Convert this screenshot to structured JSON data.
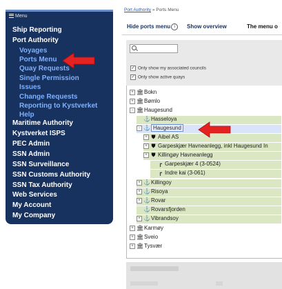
{
  "sidebar": {
    "menu_title": "Menu",
    "items": [
      {
        "label": "Ship Reporting",
        "level": 0
      },
      {
        "label": "Port Authority",
        "level": 0
      },
      {
        "label": "Voyages",
        "level": 1
      },
      {
        "label": "Ports Menu",
        "level": 1
      },
      {
        "label": "Quay Requests",
        "level": 1
      },
      {
        "label": "Single Permission",
        "level": 1
      },
      {
        "label": "Issues",
        "level": 1
      },
      {
        "label": "Change Requests",
        "level": 1
      },
      {
        "label": "Reporting to Kystverket",
        "level": 1
      },
      {
        "label": "Help",
        "level": 1
      },
      {
        "label": "Maritime Authority",
        "level": 0
      },
      {
        "label": "Kystverket ISPS",
        "level": 0
      },
      {
        "label": "PEC Admin",
        "level": 0
      },
      {
        "label": "SSN Admin",
        "level": 0
      },
      {
        "label": "SSN Surveillance",
        "level": 0
      },
      {
        "label": "SSN Customs Authority",
        "level": 0
      },
      {
        "label": "SSN Tax Authority",
        "level": 0
      },
      {
        "label": "Web Services",
        "level": 0
      },
      {
        "label": "My Account",
        "level": 0
      },
      {
        "label": "My Company",
        "level": 0
      }
    ]
  },
  "breadcrumb": {
    "link": "Port Authority",
    "separator": " » ",
    "current": "Ports Menu"
  },
  "toolbar": {
    "hide_label": "Hide ports menu",
    "info_glyph": "i",
    "overview_label": "Show overview",
    "menu_text": "The menu o"
  },
  "filters": {
    "search_value": "",
    "associated_councils_label": "Only show my associated councils",
    "active_quays_label": "Only show active quays",
    "associated_councils_checked": true,
    "active_quays_checked": true
  },
  "tree": [
    {
      "label": "Bokn",
      "icon": "building-icon",
      "expander": "+",
      "green": false,
      "selected": false
    },
    {
      "label": "Bømlo",
      "icon": "building-icon",
      "expander": "+",
      "green": false,
      "selected": false
    },
    {
      "label": "Haugesund",
      "icon": "building-icon",
      "expander": "−",
      "green": false,
      "selected": false
    },
    {
      "label": "Hasseloya",
      "icon": "anchor-icon",
      "expander": "",
      "green": true,
      "selected": false
    },
    {
      "label": "Haugesund",
      "icon": "anchor-icon",
      "expander": "−",
      "green": false,
      "selected": true
    },
    {
      "label": "Aibel AS",
      "icon": "shield-icon",
      "expander": "+",
      "green": true,
      "selected": false
    },
    {
      "label": "Garpeskjær Havneanlegg, inkl Haugesund In",
      "icon": "shield-icon",
      "expander": "+",
      "green": true,
      "selected": false
    },
    {
      "label": "Killingøy Havneanlegg",
      "icon": "shield-icon",
      "expander": "+",
      "green": true,
      "selected": false
    },
    {
      "label": "Garpeskjær 4 (3-0524)",
      "icon": "pier-icon",
      "expander": "",
      "green": true,
      "selected": false
    },
    {
      "label": "Indre kai (3-061)",
      "icon": "pier-icon",
      "expander": "",
      "green": true,
      "selected": false
    },
    {
      "label": "Killingoy",
      "icon": "anchor-icon",
      "expander": "+",
      "green": true,
      "selected": false
    },
    {
      "label": "Risoya",
      "icon": "anchor-icon",
      "expander": "+",
      "green": true,
      "selected": false
    },
    {
      "label": "Rovar",
      "icon": "anchor-icon",
      "expander": "+",
      "green": true,
      "selected": false
    },
    {
      "label": "Rovarsfjorden",
      "icon": "anchor-icon",
      "expander": "",
      "green": true,
      "selected": false
    },
    {
      "label": "Vibrandsoy",
      "icon": "anchor-icon",
      "expander": "+",
      "green": true,
      "selected": false
    },
    {
      "label": "Karmøy",
      "icon": "building-icon",
      "expander": "+",
      "green": false,
      "selected": false
    },
    {
      "label": "Sveio",
      "icon": "building-icon",
      "expander": "+",
      "green": false,
      "selected": false
    },
    {
      "label": "Tysvær",
      "icon": "building-icon",
      "expander": "+",
      "green": false,
      "selected": false
    }
  ],
  "colors": {
    "sidebar_bg": "#17325f",
    "sidebar_sub": "#7fb0ff",
    "arrow": "#e52222",
    "quay_green": "#dbe6c2",
    "selected_bg": "#d9e4f8"
  },
  "icons": {
    "building": "🏛",
    "anchor": "⚓",
    "shield": "⛊",
    "pier": "┏"
  }
}
